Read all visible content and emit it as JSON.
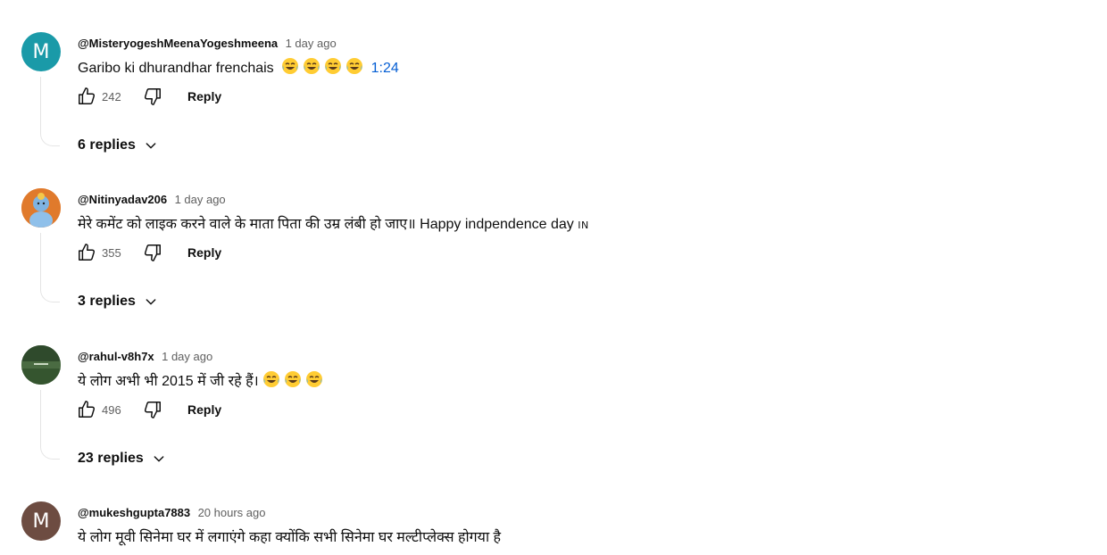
{
  "comments": [
    {
      "author": "@MisteryogeshMeenaYogeshmeena",
      "time": "1 day ago",
      "avatar_letter": "M",
      "avatar_color": "#1a9aa8",
      "text": "Garibo ki dhurandhar frenchais",
      "emoji_count": 4,
      "timestamp_link": "1:24",
      "likes": "242",
      "reply_label": "Reply",
      "replies_label": "6 replies"
    },
    {
      "author": "@Nitinyadav206",
      "time": "1 day ago",
      "avatar_letter": "",
      "avatar_color": "#e8823a",
      "text": "मेरे कमेंट को लाइक करने वाले के माता पिता की उम्र लंबी हो जाए॥ Happy indpendence day",
      "flag": "IN",
      "likes": "355",
      "reply_label": "Reply",
      "replies_label": "3 replies"
    },
    {
      "author": "@rahul-v8h7x",
      "time": "1 day ago",
      "avatar_letter": "",
      "avatar_color": "#3d5a3a",
      "text": "ये लोग अभी भी 2015 में जी रहे हैं।",
      "emoji_count": 3,
      "likes": "496",
      "reply_label": "Reply",
      "replies_label": "23 replies"
    },
    {
      "author": "@mukeshgupta7883",
      "time": "20 hours ago",
      "avatar_letter": "M",
      "avatar_color": "#6d4c41",
      "text": "ये लोग मूवी सिनेमा घर में लगाएंगे कहा क्योंकि सभी सिनेमा घर मल्टीप्लेक्स होगया है"
    }
  ],
  "icons": {
    "like": "thumbs-up-icon",
    "dislike": "thumbs-down-icon",
    "expand": "chevron-down-icon",
    "emoji": "laughing-tears-emoji-icon"
  }
}
